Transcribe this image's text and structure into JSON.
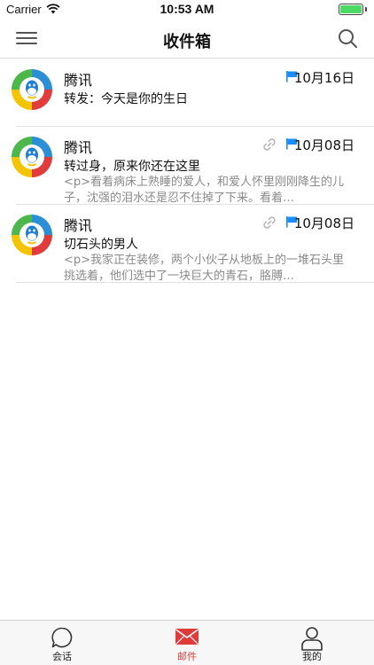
{
  "status_bar": {
    "carrier": "Carrier",
    "time": "10:53 AM",
    "battery_level": 1.0,
    "battery_color": "#4cd964"
  },
  "nav": {
    "title": "收件箱",
    "menu_icon": "menu-icon",
    "search_icon": "search-icon"
  },
  "mails": [
    {
      "from": "腾讯",
      "date": "10月16日",
      "subject": "转发：今天是你的生日",
      "preview": "",
      "flagged": true,
      "has_attachment": false
    },
    {
      "from": "腾讯",
      "date": "10月08日",
      "subject": "转过身，原来你还在这里",
      "preview": "<p>看着病床上熟睡的爱人，和爱人怀里刚刚降生的儿子，沈强的泪水还是忍不住掉了下来。看着…",
      "flagged": true,
      "has_attachment": true
    },
    {
      "from": "腾讯",
      "date": "10月08日",
      "subject": "切石头的男人",
      "preview": "<p>我家正在装修，两个小伙子从地板上的一堆石头里挑选着，他们选中了一块巨大的青石，胳膊…",
      "flagged": true,
      "has_attachment": true
    }
  ],
  "tabs": [
    {
      "label": "会话",
      "icon": "chat-bubble-icon",
      "active": false
    },
    {
      "label": "邮件",
      "icon": "envelope-icon",
      "active": true
    },
    {
      "label": "我的",
      "icon": "person-icon",
      "active": false
    }
  ],
  "colors": {
    "accent": "#e03a3a",
    "flag": "#1a8cff",
    "preview_text": "#8a8a8a"
  }
}
